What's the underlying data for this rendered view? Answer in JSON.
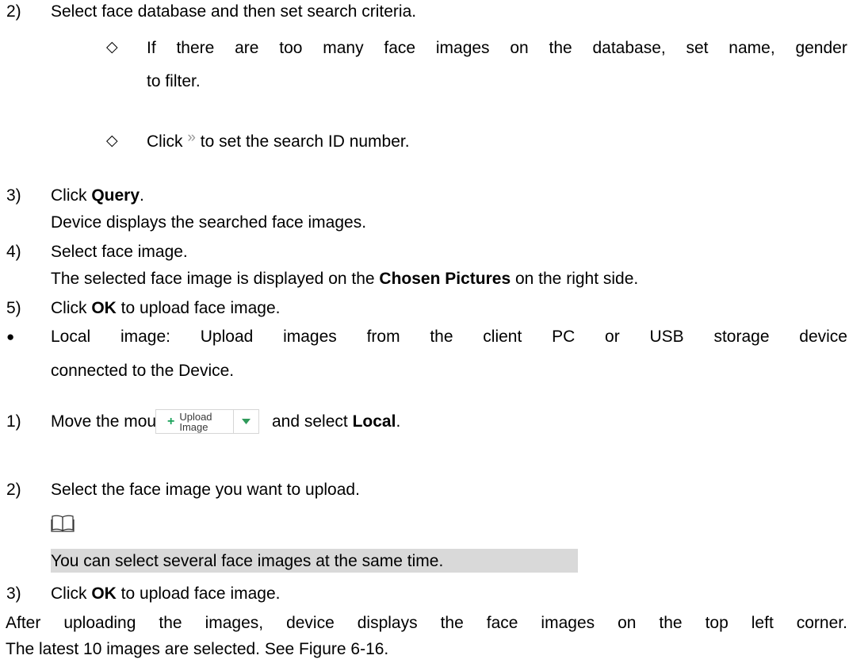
{
  "lines": {
    "s2a_num": "2)",
    "s2a_text": "Select face database and then set search criteria.",
    "d1_marker": "◇",
    "d1_l1_words": [
      "If",
      "there",
      "are",
      "too",
      "many",
      "face",
      "images",
      "on",
      "the",
      "database,",
      "set",
      "name,",
      "gender"
    ],
    "d1_l2": "to filter.",
    "d2_marker": "◇",
    "d2_pre": "Click",
    "d2_post": "to set the search ID number.",
    "s3a_num": "3)",
    "s3a_pre": "Click ",
    "s3a_bold": "Query",
    "s3a_post": ".",
    "s3a_sub": "Device displays the searched face images.",
    "s4_num": "4)",
    "s4_text": "Select face image.",
    "s4_sub_pre": "The selected face image is displayed on the ",
    "s4_sub_bold": "Chosen Pictures",
    "s4_sub_post": " on the right side.",
    "s5_num": "5)",
    "s5_pre": "Click ",
    "s5_bold": "OK",
    "s5_post": " to upload face image.",
    "b_marker": "●",
    "b_l1_words": [
      "Local",
      "image:",
      "Upload",
      "images",
      "from",
      "the",
      "client",
      "PC",
      "or",
      "USB",
      "storage",
      "device"
    ],
    "b_l2": "connected to the Device.",
    "s1_num": "1)",
    "s1_pre": "Move the mouse to",
    "s1_mid": "and select ",
    "s1_bold": "Local",
    "s1_post": ".",
    "s2b_num": "2)",
    "s2b_text": "Select the face image you want to upload.",
    "note": "You can select several face images at the same time.",
    "s3b_num": "3)",
    "s3b_pre": "Click ",
    "s3b_bold": "OK",
    "s3b_post": " to upload face image.",
    "p1_words": [
      "After",
      "uploading",
      "the",
      "images,",
      "device",
      "displays",
      "the",
      "face",
      "images",
      "on",
      "the",
      "top",
      "left",
      "corner."
    ],
    "p2": "The latest 10 images are selected. See Figure 6-16."
  },
  "upload_button": {
    "plus": "+",
    "label": "Upload Image",
    "caret": "▼"
  },
  "icons": {
    "double_chevron": "»",
    "note_icon": "book-icon"
  },
  "colors": {
    "note_highlight": "#d9d9d9",
    "button_plus": "#1aa25a",
    "button_border": "#d6d6d6"
  }
}
